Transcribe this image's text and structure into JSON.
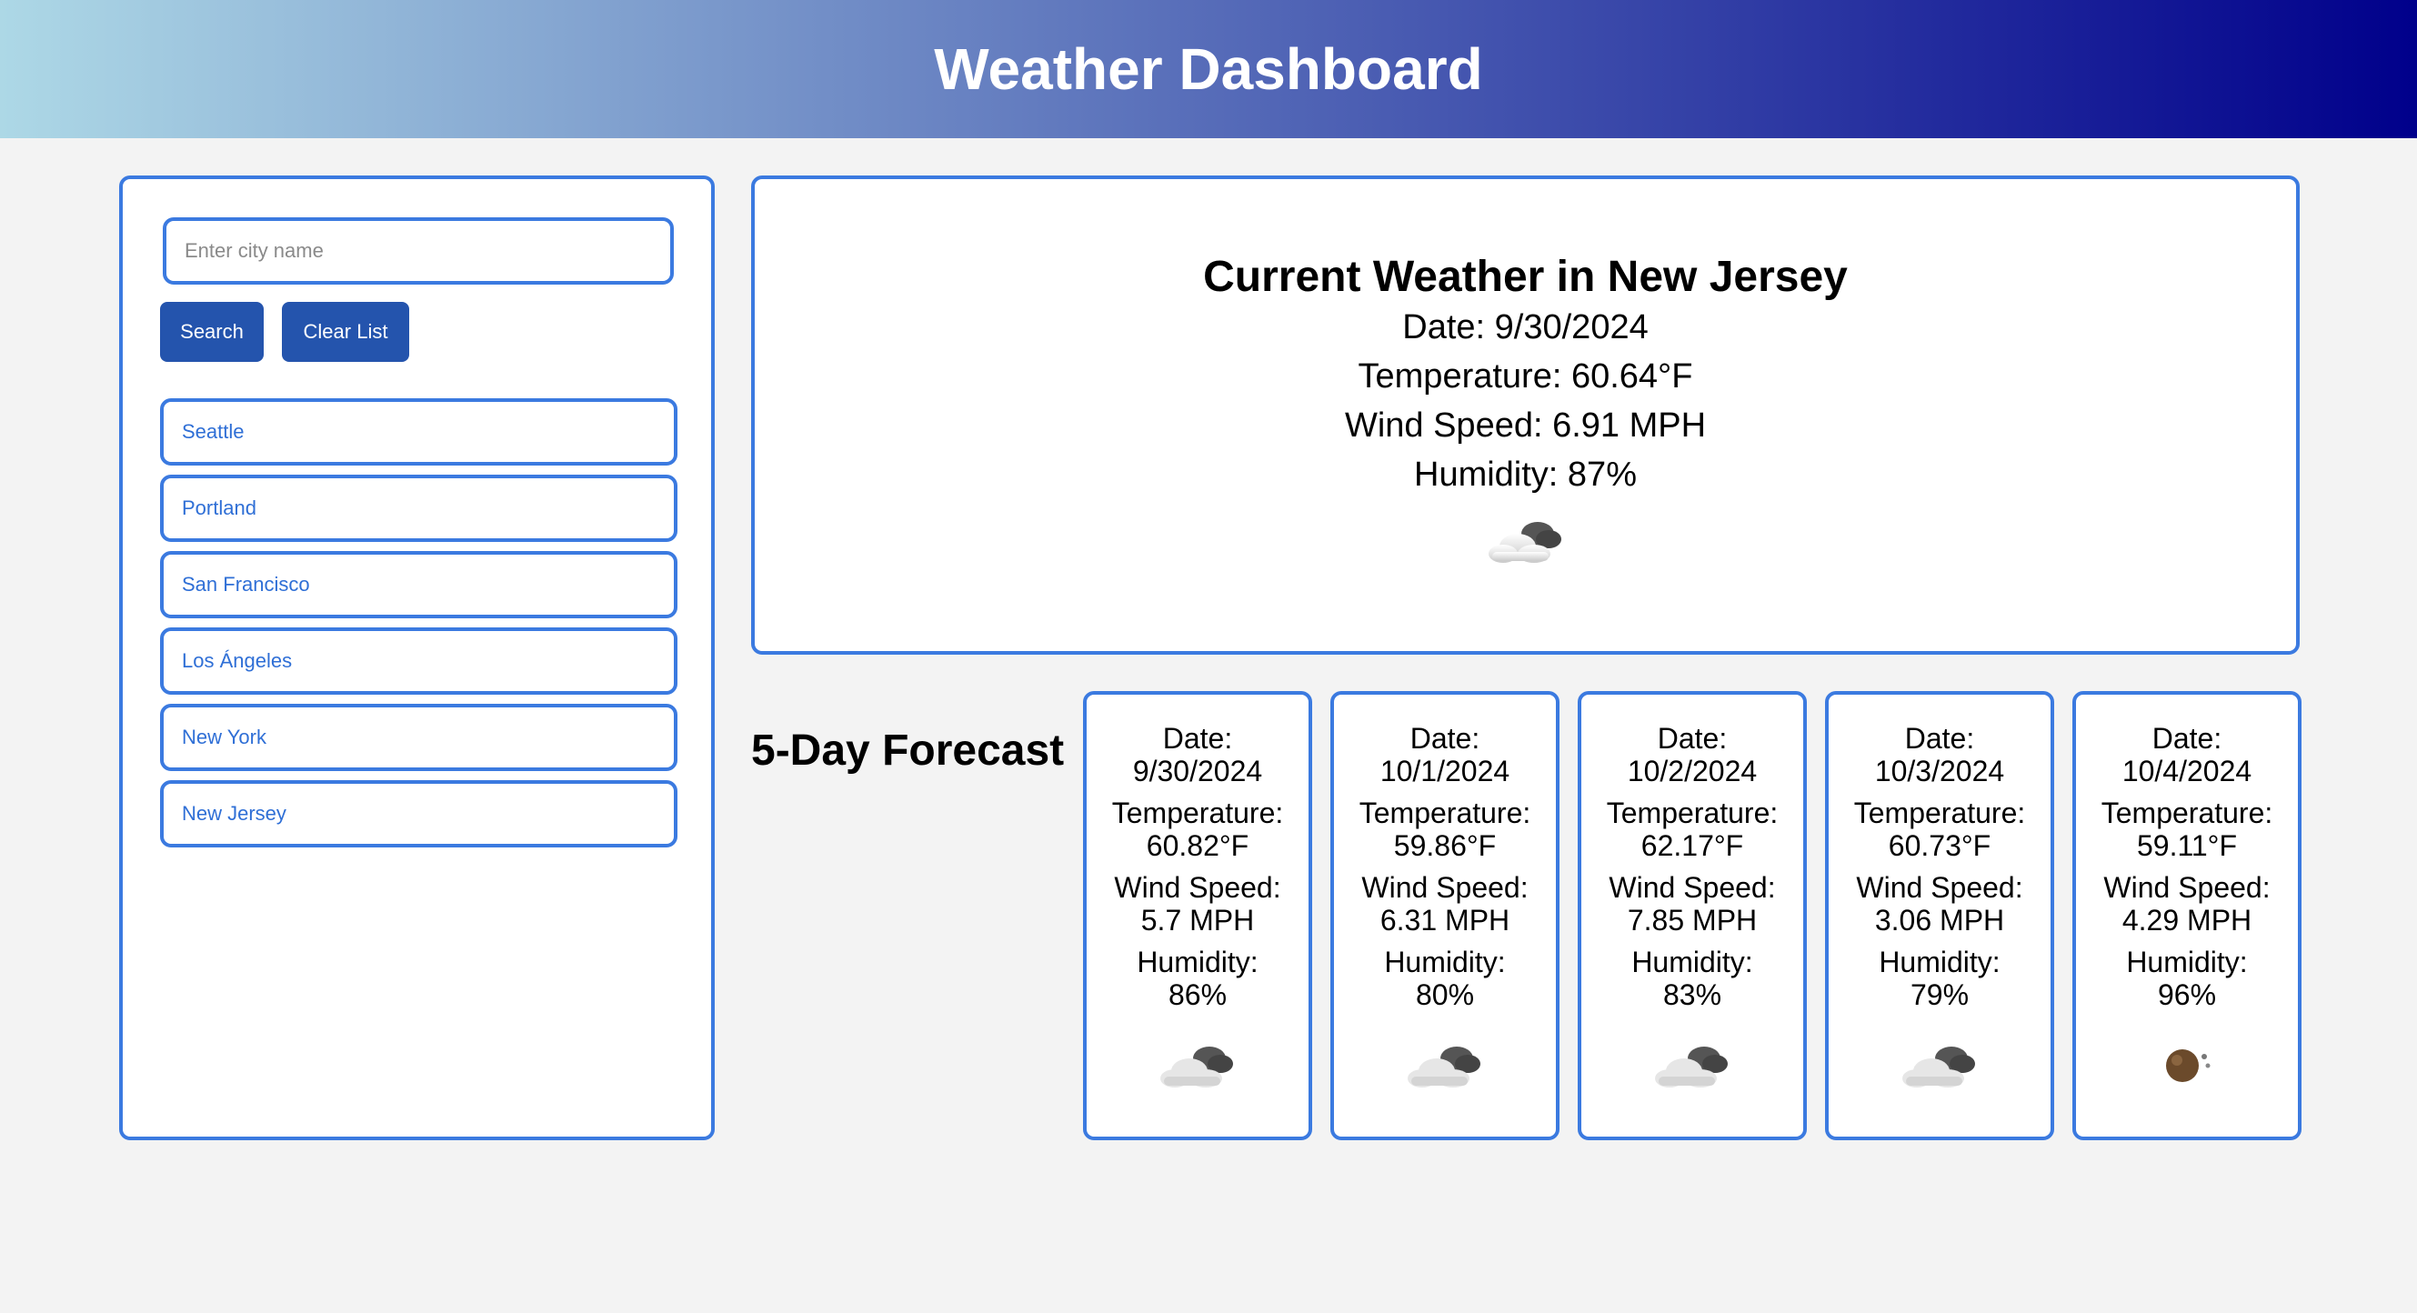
{
  "header": {
    "title": "Weather Dashboard"
  },
  "sidebar": {
    "search_placeholder": "Enter city name",
    "search_value": "",
    "search_button": "Search",
    "clear_button": "Clear List",
    "cities": [
      "Seattle",
      "Portland",
      "San Francisco",
      "Los Ángeles",
      "New York",
      "New Jersey"
    ]
  },
  "current": {
    "title": "Current Weather in New Jersey",
    "date": "Date: 9/30/2024",
    "temperature": "Temperature: 60.64°F",
    "wind": "Wind Speed: 6.91 MPH",
    "humidity": "Humidity: 87%",
    "icon": "cloud-icon"
  },
  "forecast": {
    "title": "5-Day Forecast",
    "date_label": "Date:",
    "temp_label": "Temperature:",
    "wind_label": "Wind Speed:",
    "humidity_label": "Humidity:",
    "days": [
      {
        "date": "9/30/2024",
        "temp": "60.82°F",
        "wind": "5.7 MPH",
        "humidity": "86%",
        "icon": "cloud-icon"
      },
      {
        "date": "10/1/2024",
        "temp": "59.86°F",
        "wind": "6.31 MPH",
        "humidity": "80%",
        "icon": "cloud-icon"
      },
      {
        "date": "10/2/2024",
        "temp": "62.17°F",
        "wind": "7.85 MPH",
        "humidity": "83%",
        "icon": "cloud-icon"
      },
      {
        "date": "10/3/2024",
        "temp": "60.73°F",
        "wind": "3.06 MPH",
        "humidity": "79%",
        "icon": "cloud-icon"
      },
      {
        "date": "10/4/2024",
        "temp": "59.11°F",
        "wind": "4.29 MPH",
        "humidity": "96%",
        "icon": "clear-night-icon"
      }
    ]
  },
  "colors": {
    "header_gradient_start": "#add8e6",
    "header_gradient_end": "#00008b",
    "border": "#3b7ae0",
    "button": "#2454ad",
    "city_text": "#2f6fd6"
  }
}
